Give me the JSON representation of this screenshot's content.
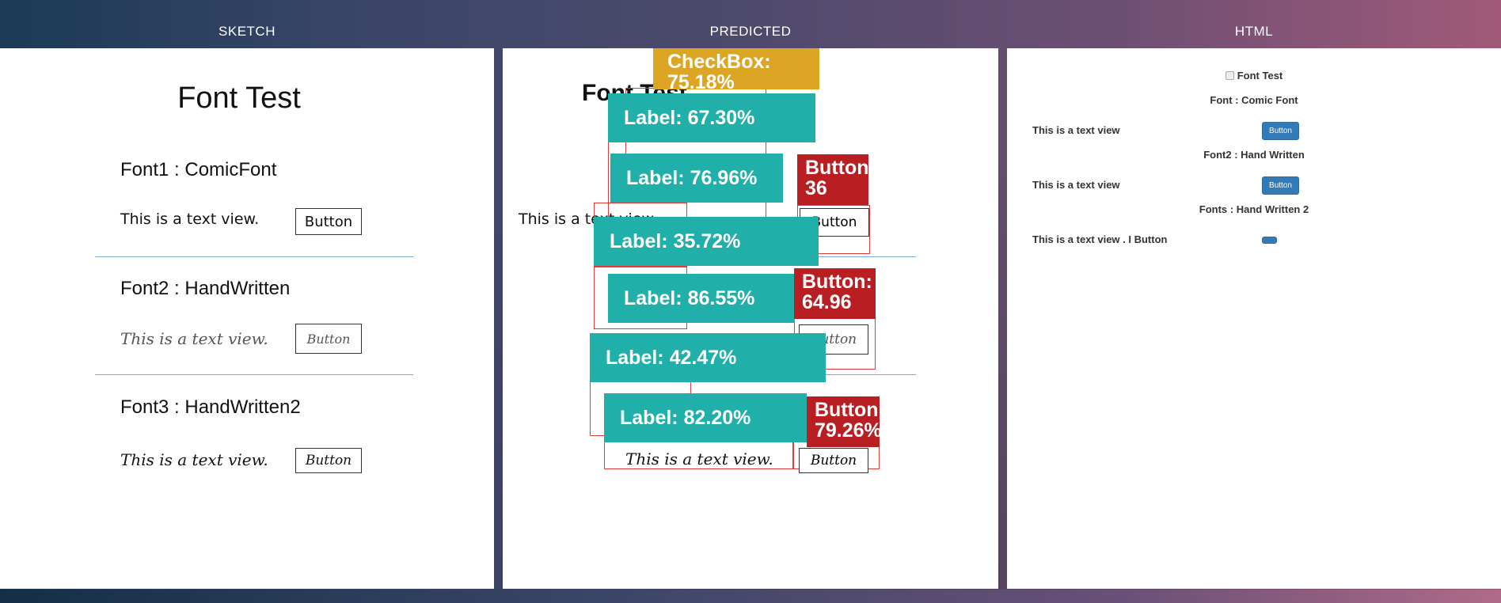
{
  "columns": {
    "sketch": "SKETCH",
    "predicted": "PREDICTED",
    "html": "HTML"
  },
  "sketch": {
    "title": "Font Test",
    "font1": "Font1 : ComicFont",
    "text1": "This is a text view.",
    "button1": "Button",
    "font2": "Font2 : HandWritten",
    "text2": "This is a text view.",
    "button2": "Button",
    "font3": "Font3 : HandWritten2",
    "text3": "This is a text view.",
    "button3": "Button"
  },
  "predicted": {
    "checkbox": "CheckBox: 75.18%",
    "labels": [
      "Label: 67.30%",
      "Label: 76.96%",
      "Label: 35.72%",
      "Label: 86.55%",
      "Label: 42.47%",
      "Label: 82.20%"
    ],
    "buttons": [
      "Button: 36",
      "Button: 64.96",
      "Button: 79.26%"
    ],
    "under_title": "Font Test",
    "under_text1": "This is a text view.",
    "under_text3": "This is a text view.",
    "under_button1": "Button",
    "under_button2": "Button",
    "under_button3": "Button",
    "colors": {
      "label": "#21b0a9",
      "checkbox": "#dca624",
      "button": "#b91f22",
      "box": "#e23a3a"
    }
  },
  "html": {
    "checkbox_label": "Font Test",
    "font1": "Font : Comic Font",
    "text1": "This is a text view",
    "button1": "Button",
    "font2": "Font2 : Hand Written",
    "text2": "This is a text view",
    "button2": "Button",
    "font3": "Fonts : Hand Written 2",
    "text3": "This is a text view . I Button"
  }
}
